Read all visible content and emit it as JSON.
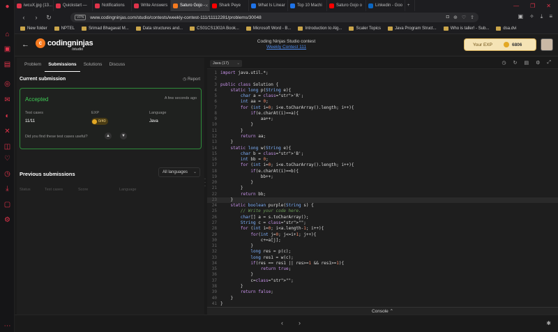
{
  "browser": {
    "tabs": [
      {
        "label": "iwcuX.jpg (13...",
        "color": "#e0334a"
      },
      {
        "label": "Quickstart —",
        "color": "#e0334a"
      },
      {
        "label": "Notifications",
        "color": "#e0334a"
      },
      {
        "label": "Write Answers",
        "color": "#e0334a"
      },
      {
        "label": "Saturo Gojo -",
        "color": "#f57a1f",
        "active": true
      },
      {
        "label": "Shark Peye",
        "color": "#ff0000"
      },
      {
        "label": "What Is Linear",
        "color": "#1e73e8"
      },
      {
        "label": "Top 10 Machi",
        "color": "#1e73e8"
      },
      {
        "label": "Saturo Gojo o",
        "color": "#ff0000"
      },
      {
        "label": "Linkedin - Goo",
        "color": "#0a66c2"
      }
    ],
    "url": "www.codingninjas.com/studio/contests/weekly-contest-111/11112281/problems/30048",
    "vpn_label": "VPN",
    "bookmarks": [
      "New folder",
      "NPTEL",
      "Srimad Bhagavat M...",
      "Data structures and...",
      "CS01CS1302A Book...",
      "Microsoft Word - B...",
      "Introduction to Alg...",
      "Scaler Topics",
      "Java Program Struct...",
      "Who is taller! - Sub...",
      "dsa.dvi"
    ]
  },
  "header": {
    "logo_text": "codingninjas",
    "logo_sub": "/studio",
    "contest_title": "Coding Ninjas Studio contest",
    "contest_link": "Weekly Contest 111",
    "exp_label": "Your EXP",
    "exp_value": "6806"
  },
  "left": {
    "tabs": [
      "Problem",
      "Submissions",
      "Solutions",
      "Discuss"
    ],
    "current_submission": "Current submission",
    "report": "Report",
    "status": "Accepted",
    "time_ago": "A few seconds ago",
    "test_cases_label": "Test cases",
    "test_cases_value": "11/11",
    "exp_label": "EXP",
    "exp_value": "0/40",
    "language_label": "Language",
    "language_value": "Java",
    "feedback_question": "Did you find these test cases useful?",
    "previous_submissions": "Previous submissions",
    "language_filter": "All languages",
    "columns": [
      "Status",
      "Test cases",
      "Score",
      "Language"
    ]
  },
  "editor": {
    "language": "Java (17)",
    "console_label": "Console",
    "lines": [
      "import java.util.*;",
      "",
      "public class Solution {",
      "    static long p(String e){",
      "        char a = 'R';",
      "        int aa = 0;",
      "        for (int i=0; i<e.toCharArray().length; i++){",
      "            if(e.charAt(i)==a){",
      "                aa++;",
      "            }",
      "        }",
      "        return aa;",
      "    }",
      "    static long w(String e){",
      "        char b = 'B';",
      "        int bb = 0;",
      "        for (int i=0; i<e.toCharArray().length; i++){",
      "            if(e.charAt(i)==b){",
      "                bb++;",
      "            }",
      "        }",
      "        return bb;",
      "    }",
      "    static boolean purple(String s) {",
      "        // Write your code here.",
      "        char[] a = s.toCharArray();",
      "        String c = \"\";",
      "        for (int i=0; i<a.length-1; i++){",
      "            for(int j=0; j<=i+1; j++){",
      "                c+=a[j];",
      "            }",
      "            long res = p(c);",
      "            long res1 = w(c);",
      "            if(res == res1 || res>=1 && res1>=1){",
      "                return true;",
      "            }",
      "            c=\"\";",
      "        }",
      "        return false;",
      "    }",
      "}"
    ]
  }
}
